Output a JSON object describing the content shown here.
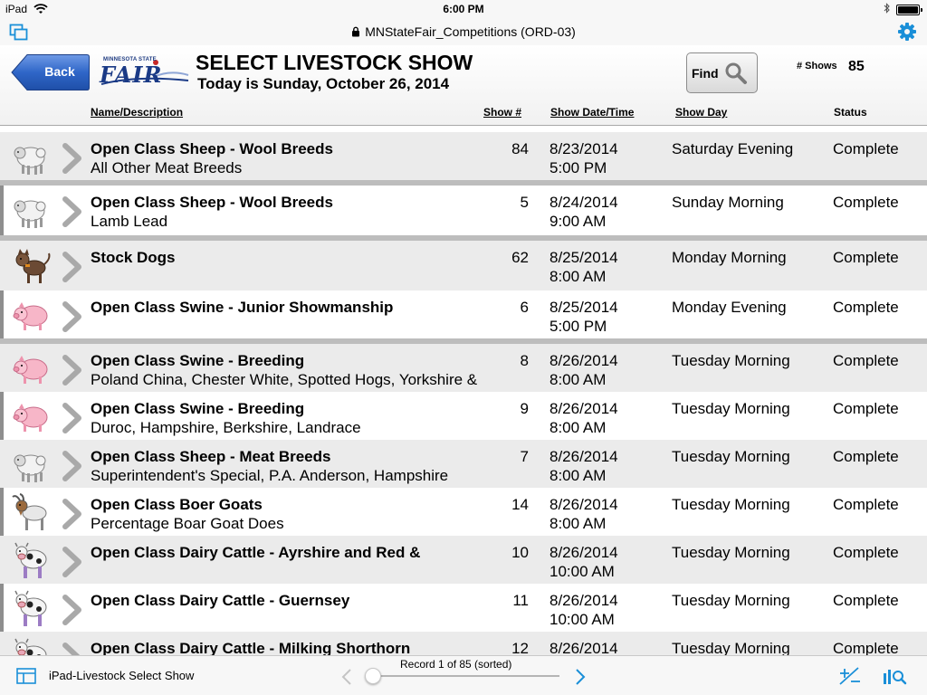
{
  "status_bar": {
    "device": "iPad",
    "time": "6:00 PM"
  },
  "nav": {
    "title": "MNStateFair_Competitions (ORD-03)"
  },
  "header": {
    "back_label": "Back",
    "logo_small": "MINNESOTA STATE",
    "logo_main": "FAIR",
    "title": "SELECT LIVESTOCK SHOW",
    "subtitle": "Today is Sunday, October 26, 2014",
    "find_label": "Find",
    "shows_label": "# Shows",
    "shows_count": "85"
  },
  "columns": {
    "name": "Name/Description",
    "show_num": "Show #",
    "date_time": "Show Date/Time",
    "day": "Show Day",
    "status": "Status"
  },
  "rows": [
    {
      "animal": "sheep-icon",
      "title": "Open Class Sheep - Wool Breeds",
      "subtitle": "All Other Meat Breeds",
      "show_num": "84",
      "date": "8/23/2014",
      "time": "5:00 PM",
      "day": "Saturday Evening",
      "status": "Complete"
    },
    {
      "animal": "sheep-icon",
      "title": "Open Class Sheep - Wool Breeds",
      "subtitle": "Lamb Lead",
      "show_num": "5",
      "date": "8/24/2014",
      "time": "9:00 AM",
      "day": "Sunday Morning",
      "status": "Complete"
    },
    {
      "animal": "dog-icon",
      "title": "Stock Dogs",
      "subtitle": "",
      "show_num": "62",
      "date": "8/25/2014",
      "time": "8:00 AM",
      "day": "Monday Morning",
      "status": "Complete"
    },
    {
      "animal": "pig-icon",
      "title": "Open Class Swine - Junior Showmanship",
      "subtitle": "",
      "show_num": "6",
      "date": "8/25/2014",
      "time": "5:00 PM",
      "day": "Monday Evening",
      "status": "Complete"
    },
    {
      "animal": "pig-icon",
      "title": "Open Class Swine - Breeding",
      "subtitle": "Poland China, Chester White, Spotted Hogs, Yorkshire &",
      "show_num": "8",
      "date": "8/26/2014",
      "time": "8:00 AM",
      "day": "Tuesday Morning",
      "status": "Complete"
    },
    {
      "animal": "pig-icon",
      "title": "Open Class Swine - Breeding",
      "subtitle": "Duroc, Hampshire, Berkshire, Landrace",
      "show_num": "9",
      "date": "8/26/2014",
      "time": "8:00 AM",
      "day": "Tuesday Morning",
      "status": "Complete"
    },
    {
      "animal": "sheep-icon",
      "title": "Open Class Sheep - Meat Breeds",
      "subtitle": "Superintendent's Special, P.A. Anderson, Hampshire",
      "show_num": "7",
      "date": "8/26/2014",
      "time": "8:00 AM",
      "day": "Tuesday Morning",
      "status": "Complete"
    },
    {
      "animal": "goat-icon",
      "title": "Open Class Boer Goats",
      "subtitle": "Percentage Boar Goat Does",
      "show_num": "14",
      "date": "8/26/2014",
      "time": "8:00 AM",
      "day": "Tuesday Morning",
      "status": "Complete"
    },
    {
      "animal": "cow-icon",
      "title": "Open Class Dairy Cattle - Ayrshire and Red &",
      "subtitle": "",
      "show_num": "10",
      "date": "8/26/2014",
      "time": "10:00 AM",
      "day": "Tuesday Morning",
      "status": "Complete"
    },
    {
      "animal": "cow-icon",
      "title": "Open Class Dairy Cattle - Guernsey",
      "subtitle": "",
      "show_num": "11",
      "date": "8/26/2014",
      "time": "10:00 AM",
      "day": "Tuesday Morning",
      "status": "Complete"
    },
    {
      "animal": "cow-icon",
      "title": "Open Class Dairy Cattle - Milking Shorthorn",
      "subtitle": "",
      "show_num": "12",
      "date": "8/26/2014",
      "time": "",
      "day": "Tuesday Morning",
      "status": "Complete"
    }
  ],
  "toolbar": {
    "layout_name": "iPad-Livestock Select Show",
    "record_text": "Record 1 of 85 (sorted)"
  },
  "colors": {
    "accent": "#1a8fd8",
    "back_button": "#2f66c8",
    "row_gray": "#ebebeb",
    "separator": "#bdbdbd"
  }
}
